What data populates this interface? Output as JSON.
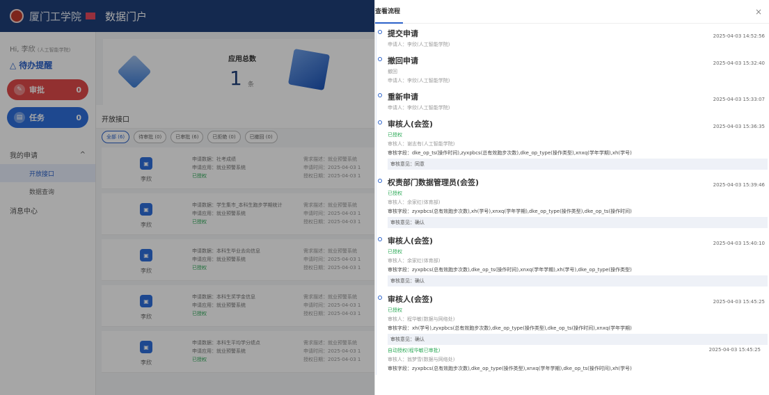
{
  "header": {
    "school_name": "厦门工学院",
    "portal_title": "数据门户"
  },
  "sidebar": {
    "greeting": "Hi, 李欣",
    "department": "(人工智能学院)",
    "todo_title": "待办提醒",
    "approve": {
      "label": "审批",
      "count": "0"
    },
    "task": {
      "label": "任务",
      "count": "0"
    },
    "menu_group": "我的申请",
    "items": [
      "开放接口",
      "数据查询"
    ],
    "message_center": "消息中心"
  },
  "stats": {
    "label": "应用总数",
    "value": "1",
    "unit": "条"
  },
  "main": {
    "section_title": "开放接口",
    "filters": [
      "全部 (6)",
      "待审批 (0)",
      "已审批 (6)",
      "已拒绝 (0)",
      "已撤回 (0)"
    ],
    "cards": [
      {
        "applicant": "李欣",
        "dataset": "申请数据：社考成绩",
        "app": "申请应用：就业预警系统",
        "status": "已授权",
        "desc": "需求描述：就业预警系统",
        "time": "申请时间：2025-04-03 1",
        "auth": "授权日期：2025-04-03 1"
      },
      {
        "applicant": "李欣",
        "dataset": "申请数据：学生集市_本科生跑步学期统计",
        "app": "申请应用：就业预警系统",
        "status": "已授权",
        "desc": "需求描述：就业预警系统",
        "time": "申请时间：2025-04-03 1",
        "auth": "授权日期：2025-04-03 1"
      },
      {
        "applicant": "李欣",
        "dataset": "申请数据：本科生毕业去向信息",
        "app": "申请应用：就业预警系统",
        "status": "已授权",
        "desc": "需求描述：就业预警系统",
        "time": "申请时间：2025-04-03 1",
        "auth": "授权日期：2025-04-03 1"
      },
      {
        "applicant": "李欣",
        "dataset": "申请数据：本科生奖学金信息",
        "app": "申请应用：就业预警系统",
        "status": "已授权",
        "desc": "需求描述：就业预警系统",
        "time": "申请时间：2025-04-03 1",
        "auth": "授权日期：2025-04-03 1"
      },
      {
        "applicant": "李欣",
        "dataset": "申请数据：本科生平均学分绩点",
        "app": "申请应用：就业预警系统",
        "status": "已授权",
        "desc": "需求描述：就业预警系统",
        "time": "申请时间：2025-04-03 1",
        "auth": "授权日期：2025-04-03 1"
      }
    ]
  },
  "drawer": {
    "title": "查看流程",
    "close": "×",
    "steps": [
      {
        "title": "提交申请",
        "lines": [
          "申请人：李欣(人工智能学院)"
        ],
        "time": "2025-04-03 14:52:56"
      },
      {
        "title": "撤回申请",
        "lines": [
          "撤回",
          "申请人：李欣(人工智能学院)"
        ],
        "time": "2025-04-03 15:32:40"
      },
      {
        "title": "重新申请",
        "lines": [
          "申请人：李欣(人工智能学院)"
        ],
        "time": "2025-04-03 15:33:07"
      },
      {
        "title": "审核人(会签)",
        "status": "已授权",
        "reviewer": "审核人：谢志有(人工智能学院)",
        "fields": "审核字段：dke_op_ts(操作时间),zyxpbcs(总有效跑步次数),dke_op_type(操作类型),xnxq(学年学期),xh(学号)",
        "opinion": "审核意见：同意",
        "time": "2025-04-03 15:36:35"
      },
      {
        "title": "权责部门数据管理员(会签)",
        "status": "已授权",
        "reviewer": "审核人：余家红(体育部)",
        "fields": "审核字段：zyxpbcs(总有效跑步次数),xh(学号),xnxq(学年学期),dke_op_type(操作类型),dke_op_ts(操作时间)",
        "opinion": "审核意见：确认",
        "time": "2025-04-03 15:39:46"
      },
      {
        "title": "审核人(会签)",
        "status": "已授权",
        "reviewer": "审核人：余家红(体育部)",
        "fields": "审核字段：zyxpbcs(总有效跑步次数),dke_op_ts(操作时间),xnxq(学年学期),xh(学号),dke_op_type(操作类型)",
        "opinion": "审核意见：确认",
        "time": "2025-04-03 15:40:10"
      },
      {
        "title": "审核人(会签)",
        "status": "已授权",
        "reviewer": "审核人：程华敏(数据与网络处)",
        "fields": "审核字段：xh(学号),zyxpbcs(总有效跑步次数),dke_op_type(操作类型),dke_op_ts(操作时间),xnxq(学年学期)",
        "opinion": "审核意见：确认",
        "time": "2025-04-03 15:45:25",
        "auto": {
          "status": "自动授权(程华敏已审批)",
          "reviewer": "审核人：翁梦雪(数据与网络处)",
          "fields": "审核字段：zyxpbcs(总有效跑步次数),dke_op_type(操作类型),xnxq(学年学期),dke_op_ts(操作时间),xh(学号)",
          "time": "2025-04-03 15:45:25"
        }
      }
    ]
  }
}
